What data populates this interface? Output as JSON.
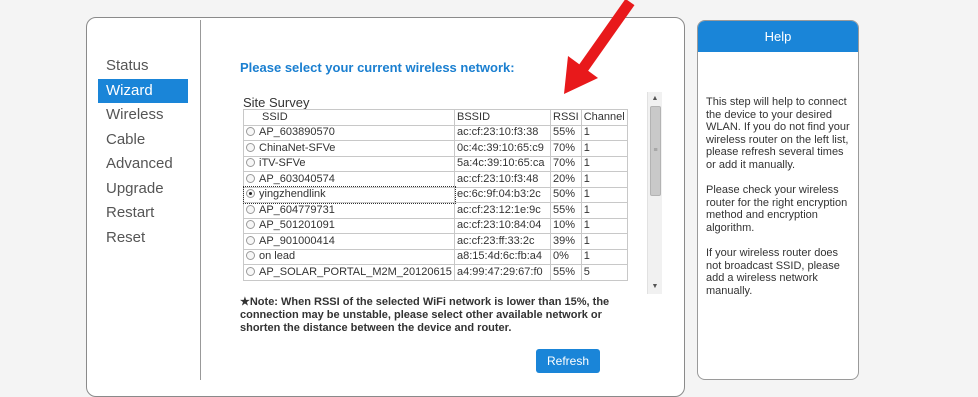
{
  "nav": {
    "items": [
      {
        "label": "Status"
      },
      {
        "label": "Wizard",
        "active": true
      },
      {
        "label": "Wireless"
      },
      {
        "label": "Cable"
      },
      {
        "label": "Advanced"
      },
      {
        "label": "Upgrade"
      },
      {
        "label": "Restart"
      },
      {
        "label": "Reset"
      }
    ]
  },
  "main": {
    "title": "Please select your current wireless network:",
    "survey_caption": "Site Survey",
    "columns": [
      "SSID",
      "BSSID",
      "RSSI",
      "Channel"
    ],
    "rows": [
      {
        "ssid": "AP_603890570",
        "bssid": "ac:cf:23:10:f3:38",
        "rssi": "55%",
        "channel": "1",
        "selected": false
      },
      {
        "ssid": "ChinaNet-SFVe",
        "bssid": "0c:4c:39:10:65:c9",
        "rssi": "70%",
        "channel": "1",
        "selected": false
      },
      {
        "ssid": "iTV-SFVe",
        "bssid": "5a:4c:39:10:65:ca",
        "rssi": "70%",
        "channel": "1",
        "selected": false
      },
      {
        "ssid": "AP_603040574",
        "bssid": "ac:cf:23:10:f3:48",
        "rssi": "20%",
        "channel": "1",
        "selected": false
      },
      {
        "ssid": "yingzhendlink",
        "bssid": "ec:6c:9f:04:b3:2c",
        "rssi": "50%",
        "channel": "1",
        "selected": true
      },
      {
        "ssid": "AP_604779731",
        "bssid": "ac:cf:23:12:1e:9c",
        "rssi": "55%",
        "channel": "1",
        "selected": false
      },
      {
        "ssid": "AP_501201091",
        "bssid": "ac:cf:23:10:84:04",
        "rssi": "10%",
        "channel": "1",
        "selected": false
      },
      {
        "ssid": "AP_901000414",
        "bssid": "ac:cf:23:ff:33:2c",
        "rssi": "39%",
        "channel": "1",
        "selected": false
      },
      {
        "ssid": "on lead",
        "bssid": "a8:15:4d:6c:fb:a4",
        "rssi": "0%",
        "channel": "1",
        "selected": false
      },
      {
        "ssid": "AP_SOLAR_PORTAL_M2M_20120615",
        "bssid": "a4:99:47:29:67:f0",
        "rssi": "55%",
        "channel": "5",
        "selected": false
      }
    ],
    "note": "★Note: When RSSI of the selected WiFi network is lower than 15%, the connection may be unstable, please select other available network or shorten the distance between the device and router.",
    "refresh_label": "Refresh"
  },
  "help": {
    "title": "Help",
    "paragraphs": [
      "This step will help to connect the device to your desired WLAN. If you do not find your wireless router on the left list, please refresh several times or add it manually.",
      "Please check your wireless router for the right encryption method and encryption algorithm.",
      "If your wireless router does not broadcast SSID, please add a wireless network manually."
    ]
  },
  "colors": {
    "accent": "#1a85d8",
    "title": "#1a7fd0",
    "arrow": "#e8191b"
  }
}
